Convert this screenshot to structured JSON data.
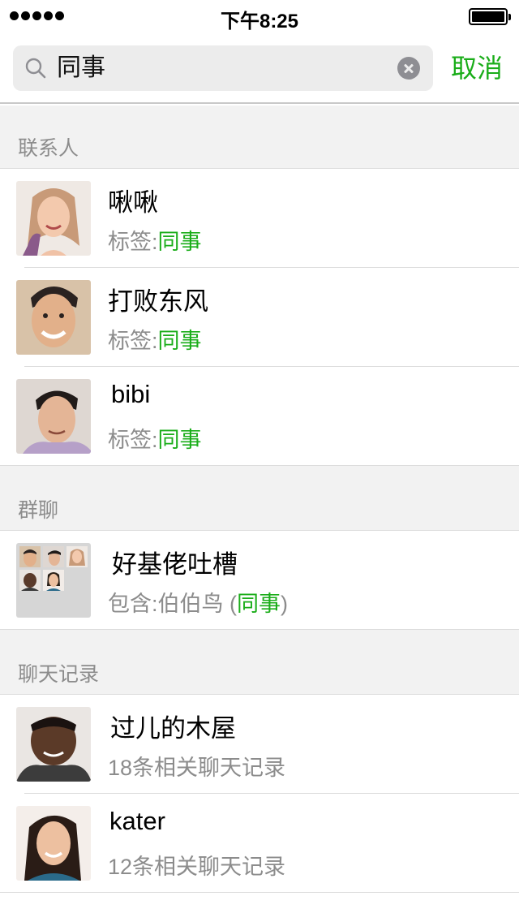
{
  "status_bar": {
    "time": "下午8:25"
  },
  "search": {
    "query": "同事",
    "cancel_label": "取消"
  },
  "sections": {
    "contacts": {
      "title": "联系人"
    },
    "groups": {
      "title": "群聊"
    },
    "chat_history": {
      "title": "聊天记录"
    }
  },
  "contacts": [
    {
      "name": "啾啾",
      "tag_prefix": "标签:",
      "tag": "同事"
    },
    {
      "name": "打败东风",
      "tag_prefix": "标签:",
      "tag": "同事"
    },
    {
      "name": "bibi",
      "tag_prefix": "标签:",
      "tag": "同事"
    }
  ],
  "groups": [
    {
      "name": "好基佬吐槽",
      "sub_prefix": "包含:伯伯鸟 (",
      "sub_highlight": "同事",
      "sub_suffix": ")"
    }
  ],
  "chat_history": [
    {
      "name": "过儿的木屋",
      "sub": "18条相关聊天记录"
    },
    {
      "name": "kater",
      "sub": "12条相关聊天记录"
    }
  ],
  "colors": {
    "accent": "#1aad19",
    "secondary_text": "#8c8c8c",
    "section_bg": "#f2f2f2"
  }
}
